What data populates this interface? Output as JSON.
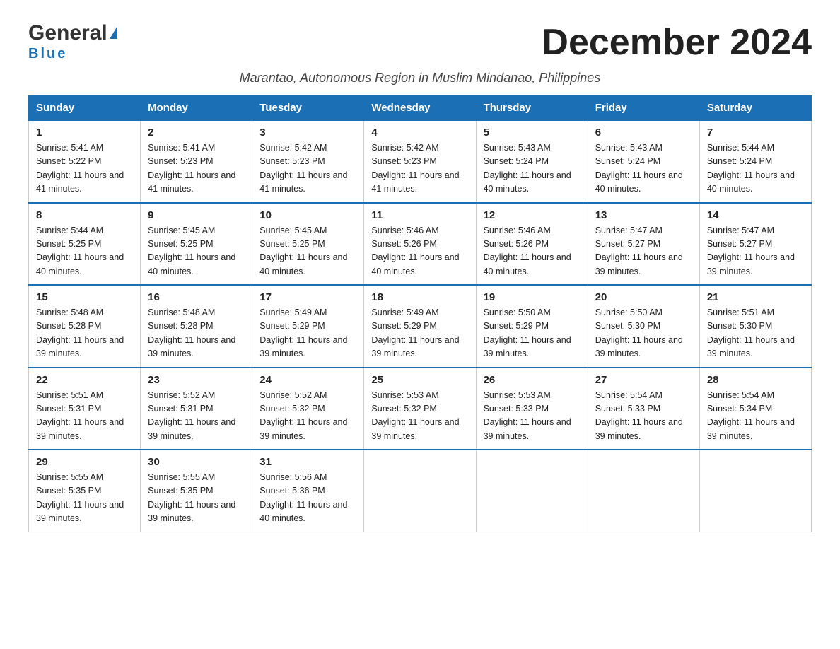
{
  "logo": {
    "text_general": "General",
    "text_triangle": "▲",
    "text_blue": "Blue"
  },
  "title": "December 2024",
  "subtitle": "Marantao, Autonomous Region in Muslim Mindanao, Philippines",
  "days_of_week": [
    "Sunday",
    "Monday",
    "Tuesday",
    "Wednesday",
    "Thursday",
    "Friday",
    "Saturday"
  ],
  "weeks": [
    [
      {
        "day": "1",
        "sunrise": "Sunrise: 5:41 AM",
        "sunset": "Sunset: 5:22 PM",
        "daylight": "Daylight: 11 hours and 41 minutes."
      },
      {
        "day": "2",
        "sunrise": "Sunrise: 5:41 AM",
        "sunset": "Sunset: 5:23 PM",
        "daylight": "Daylight: 11 hours and 41 minutes."
      },
      {
        "day": "3",
        "sunrise": "Sunrise: 5:42 AM",
        "sunset": "Sunset: 5:23 PM",
        "daylight": "Daylight: 11 hours and 41 minutes."
      },
      {
        "day": "4",
        "sunrise": "Sunrise: 5:42 AM",
        "sunset": "Sunset: 5:23 PM",
        "daylight": "Daylight: 11 hours and 41 minutes."
      },
      {
        "day": "5",
        "sunrise": "Sunrise: 5:43 AM",
        "sunset": "Sunset: 5:24 PM",
        "daylight": "Daylight: 11 hours and 40 minutes."
      },
      {
        "day": "6",
        "sunrise": "Sunrise: 5:43 AM",
        "sunset": "Sunset: 5:24 PM",
        "daylight": "Daylight: 11 hours and 40 minutes."
      },
      {
        "day": "7",
        "sunrise": "Sunrise: 5:44 AM",
        "sunset": "Sunset: 5:24 PM",
        "daylight": "Daylight: 11 hours and 40 minutes."
      }
    ],
    [
      {
        "day": "8",
        "sunrise": "Sunrise: 5:44 AM",
        "sunset": "Sunset: 5:25 PM",
        "daylight": "Daylight: 11 hours and 40 minutes."
      },
      {
        "day": "9",
        "sunrise": "Sunrise: 5:45 AM",
        "sunset": "Sunset: 5:25 PM",
        "daylight": "Daylight: 11 hours and 40 minutes."
      },
      {
        "day": "10",
        "sunrise": "Sunrise: 5:45 AM",
        "sunset": "Sunset: 5:25 PM",
        "daylight": "Daylight: 11 hours and 40 minutes."
      },
      {
        "day": "11",
        "sunrise": "Sunrise: 5:46 AM",
        "sunset": "Sunset: 5:26 PM",
        "daylight": "Daylight: 11 hours and 40 minutes."
      },
      {
        "day": "12",
        "sunrise": "Sunrise: 5:46 AM",
        "sunset": "Sunset: 5:26 PM",
        "daylight": "Daylight: 11 hours and 40 minutes."
      },
      {
        "day": "13",
        "sunrise": "Sunrise: 5:47 AM",
        "sunset": "Sunset: 5:27 PM",
        "daylight": "Daylight: 11 hours and 39 minutes."
      },
      {
        "day": "14",
        "sunrise": "Sunrise: 5:47 AM",
        "sunset": "Sunset: 5:27 PM",
        "daylight": "Daylight: 11 hours and 39 minutes."
      }
    ],
    [
      {
        "day": "15",
        "sunrise": "Sunrise: 5:48 AM",
        "sunset": "Sunset: 5:28 PM",
        "daylight": "Daylight: 11 hours and 39 minutes."
      },
      {
        "day": "16",
        "sunrise": "Sunrise: 5:48 AM",
        "sunset": "Sunset: 5:28 PM",
        "daylight": "Daylight: 11 hours and 39 minutes."
      },
      {
        "day": "17",
        "sunrise": "Sunrise: 5:49 AM",
        "sunset": "Sunset: 5:29 PM",
        "daylight": "Daylight: 11 hours and 39 minutes."
      },
      {
        "day": "18",
        "sunrise": "Sunrise: 5:49 AM",
        "sunset": "Sunset: 5:29 PM",
        "daylight": "Daylight: 11 hours and 39 minutes."
      },
      {
        "day": "19",
        "sunrise": "Sunrise: 5:50 AM",
        "sunset": "Sunset: 5:29 PM",
        "daylight": "Daylight: 11 hours and 39 minutes."
      },
      {
        "day": "20",
        "sunrise": "Sunrise: 5:50 AM",
        "sunset": "Sunset: 5:30 PM",
        "daylight": "Daylight: 11 hours and 39 minutes."
      },
      {
        "day": "21",
        "sunrise": "Sunrise: 5:51 AM",
        "sunset": "Sunset: 5:30 PM",
        "daylight": "Daylight: 11 hours and 39 minutes."
      }
    ],
    [
      {
        "day": "22",
        "sunrise": "Sunrise: 5:51 AM",
        "sunset": "Sunset: 5:31 PM",
        "daylight": "Daylight: 11 hours and 39 minutes."
      },
      {
        "day": "23",
        "sunrise": "Sunrise: 5:52 AM",
        "sunset": "Sunset: 5:31 PM",
        "daylight": "Daylight: 11 hours and 39 minutes."
      },
      {
        "day": "24",
        "sunrise": "Sunrise: 5:52 AM",
        "sunset": "Sunset: 5:32 PM",
        "daylight": "Daylight: 11 hours and 39 minutes."
      },
      {
        "day": "25",
        "sunrise": "Sunrise: 5:53 AM",
        "sunset": "Sunset: 5:32 PM",
        "daylight": "Daylight: 11 hours and 39 minutes."
      },
      {
        "day": "26",
        "sunrise": "Sunrise: 5:53 AM",
        "sunset": "Sunset: 5:33 PM",
        "daylight": "Daylight: 11 hours and 39 minutes."
      },
      {
        "day": "27",
        "sunrise": "Sunrise: 5:54 AM",
        "sunset": "Sunset: 5:33 PM",
        "daylight": "Daylight: 11 hours and 39 minutes."
      },
      {
        "day": "28",
        "sunrise": "Sunrise: 5:54 AM",
        "sunset": "Sunset: 5:34 PM",
        "daylight": "Daylight: 11 hours and 39 minutes."
      }
    ],
    [
      {
        "day": "29",
        "sunrise": "Sunrise: 5:55 AM",
        "sunset": "Sunset: 5:35 PM",
        "daylight": "Daylight: 11 hours and 39 minutes."
      },
      {
        "day": "30",
        "sunrise": "Sunrise: 5:55 AM",
        "sunset": "Sunset: 5:35 PM",
        "daylight": "Daylight: 11 hours and 39 minutes."
      },
      {
        "day": "31",
        "sunrise": "Sunrise: 5:56 AM",
        "sunset": "Sunset: 5:36 PM",
        "daylight": "Daylight: 11 hours and 40 minutes."
      },
      null,
      null,
      null,
      null
    ]
  ]
}
